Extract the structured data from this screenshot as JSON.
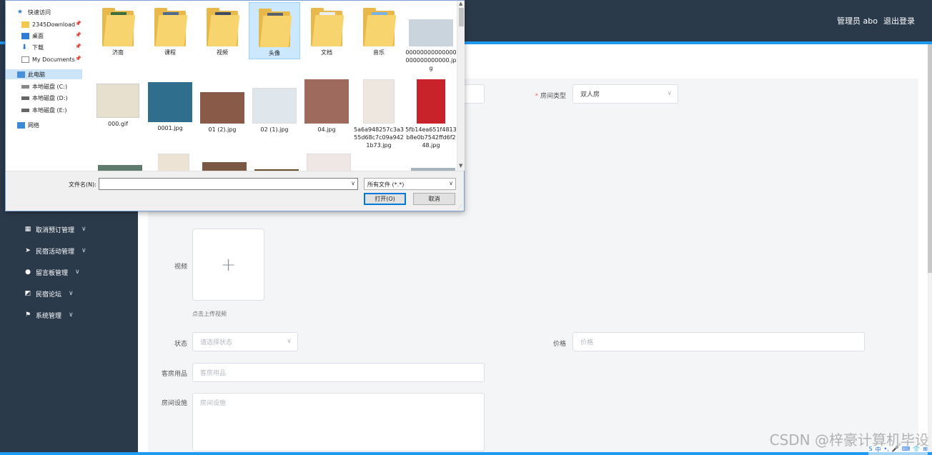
{
  "header": {
    "user_label": "管理员 abo",
    "logout_label": "退出登录"
  },
  "sidebar": {
    "items": [
      {
        "label": "取消预订管理",
        "icon": "grid-icon"
      },
      {
        "label": "民宿活动管理",
        "icon": "send-icon"
      },
      {
        "label": "留言板管理",
        "icon": "user-icon"
      },
      {
        "label": "民宿论坛",
        "icon": "chart-icon"
      },
      {
        "label": "系统管理",
        "icon": "flag-icon"
      }
    ],
    "chevron": "∨"
  },
  "form": {
    "room_type": {
      "label": "房间类型",
      "value": "双人房"
    },
    "video": {
      "label": "视频",
      "hint": "点击上传视频"
    },
    "status": {
      "label": "状态",
      "placeholder": "请选择状态"
    },
    "price": {
      "label": "价格",
      "placeholder": "价格"
    },
    "supplies": {
      "label": "客房用品",
      "placeholder": "客房用品"
    },
    "facilities": {
      "label": "房间设施",
      "placeholder": "房间设施"
    },
    "upload_plus": "+"
  },
  "dialog": {
    "nav": [
      {
        "label": "快速访问",
        "icon": "star-icon"
      },
      {
        "label": "2345Download",
        "icon": "folder-icon",
        "pinned": true
      },
      {
        "label": "桌面",
        "icon": "desktop-icon",
        "pinned": true
      },
      {
        "label": "下载",
        "icon": "download-icon",
        "pinned": true
      },
      {
        "label": "My Documents",
        "icon": "documents-icon",
        "pinned": true
      },
      {
        "label": "此电脑",
        "icon": "computer-icon",
        "selected": true
      },
      {
        "label": "本地磁盘 (C:)",
        "icon": "drive-icon"
      },
      {
        "label": "本地磁盘 (D:)",
        "icon": "drive-icon"
      },
      {
        "label": "本地磁盘 (E:)",
        "icon": "drive-icon"
      },
      {
        "label": "网络",
        "icon": "network-icon"
      }
    ],
    "pin_glyph": "📌",
    "files": [
      {
        "name": "济南",
        "kind": "folder",
        "color": "#3a6e3f"
      },
      {
        "name": "课程",
        "kind": "folder",
        "color": "#4c6b8f"
      },
      {
        "name": "视频",
        "kind": "folder",
        "color": "#3d4a63"
      },
      {
        "name": "头像",
        "kind": "folder",
        "color": "#54606c",
        "selected": true
      },
      {
        "name": "文档",
        "kind": "folder",
        "color": "#e9eef2"
      },
      {
        "name": "音乐",
        "kind": "folder",
        "color": "#7ab1e3"
      },
      {
        "name": "00000000000000000000000000.jpg",
        "kind": "image",
        "color": "#c9d4dc"
      },
      {
        "name": "000.gif",
        "kind": "image",
        "color": "#e7e0cf"
      },
      {
        "name": "0001.jpg",
        "kind": "image",
        "color": "#2f6f8d"
      },
      {
        "name": "01 (2).jpg",
        "kind": "image",
        "color": "#8a5a48"
      },
      {
        "name": "02 (1).jpg",
        "kind": "image",
        "color": "#dfe6ec"
      },
      {
        "name": "04.jpg",
        "kind": "image",
        "color": "#9e6a5e"
      },
      {
        "name": "5a6a948257c3a355d68c7c09a9421b73.jpg",
        "kind": "image",
        "color": "#ede7df"
      },
      {
        "name": "5fb14ea651f4813b8e0b7542ffd6f248.jpg",
        "kind": "image",
        "color": "#c8232b"
      }
    ],
    "filename_label": "文件名(N):",
    "filename_value": "",
    "filetype_value": "所有文件 (*.*)",
    "open_label": "打开(O)",
    "cancel_label": "取消",
    "dropdown_glyph": "∨"
  },
  "watermark": "CSDN @梓豪计算机毕设",
  "tray": [
    "S",
    "中",
    "•,",
    "🎤",
    "⌨",
    "👕",
    "⊞"
  ]
}
